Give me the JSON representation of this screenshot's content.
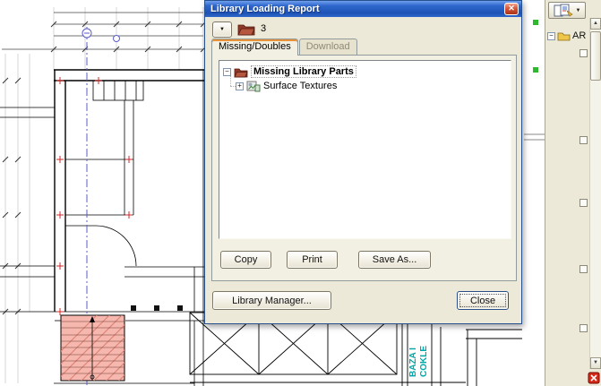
{
  "dialog": {
    "title": "Library Loading Report",
    "close_glyph": "✕",
    "toolbar": {
      "dropdown_glyph": "▼",
      "missing_count": "3"
    },
    "tabs": [
      {
        "label": "Missing/Doubles"
      },
      {
        "label": "Download"
      }
    ],
    "tree": {
      "root_expander": "−",
      "root_label": "Missing Library Parts",
      "child_expander": "+",
      "child_label": "Surface Textures"
    },
    "buttons": {
      "copy": "Copy",
      "print": "Print",
      "save_as": "Save As...",
      "library_manager": "Library Manager...",
      "close": "Close"
    }
  },
  "side_panel": {
    "toolbar_dropdown_glyph": "▼",
    "root_expander": "−",
    "root_label": "AR",
    "scrollbar": {
      "up_glyph": "▲",
      "down_glyph": "▼"
    }
  },
  "drawing": {
    "annotation_1": "BAZA I",
    "annotation_2": "COKLE"
  },
  "colors": {
    "dialog_bg": "#ECE9D8",
    "titlebar_blue": "#2F67CC",
    "close_red": "#D6573B",
    "annotation_teal": "#00A9A9",
    "stair_fill": "#F6B7AE",
    "folder_red": "#8F3A28",
    "section_line_blue": "#5C5CCD"
  }
}
